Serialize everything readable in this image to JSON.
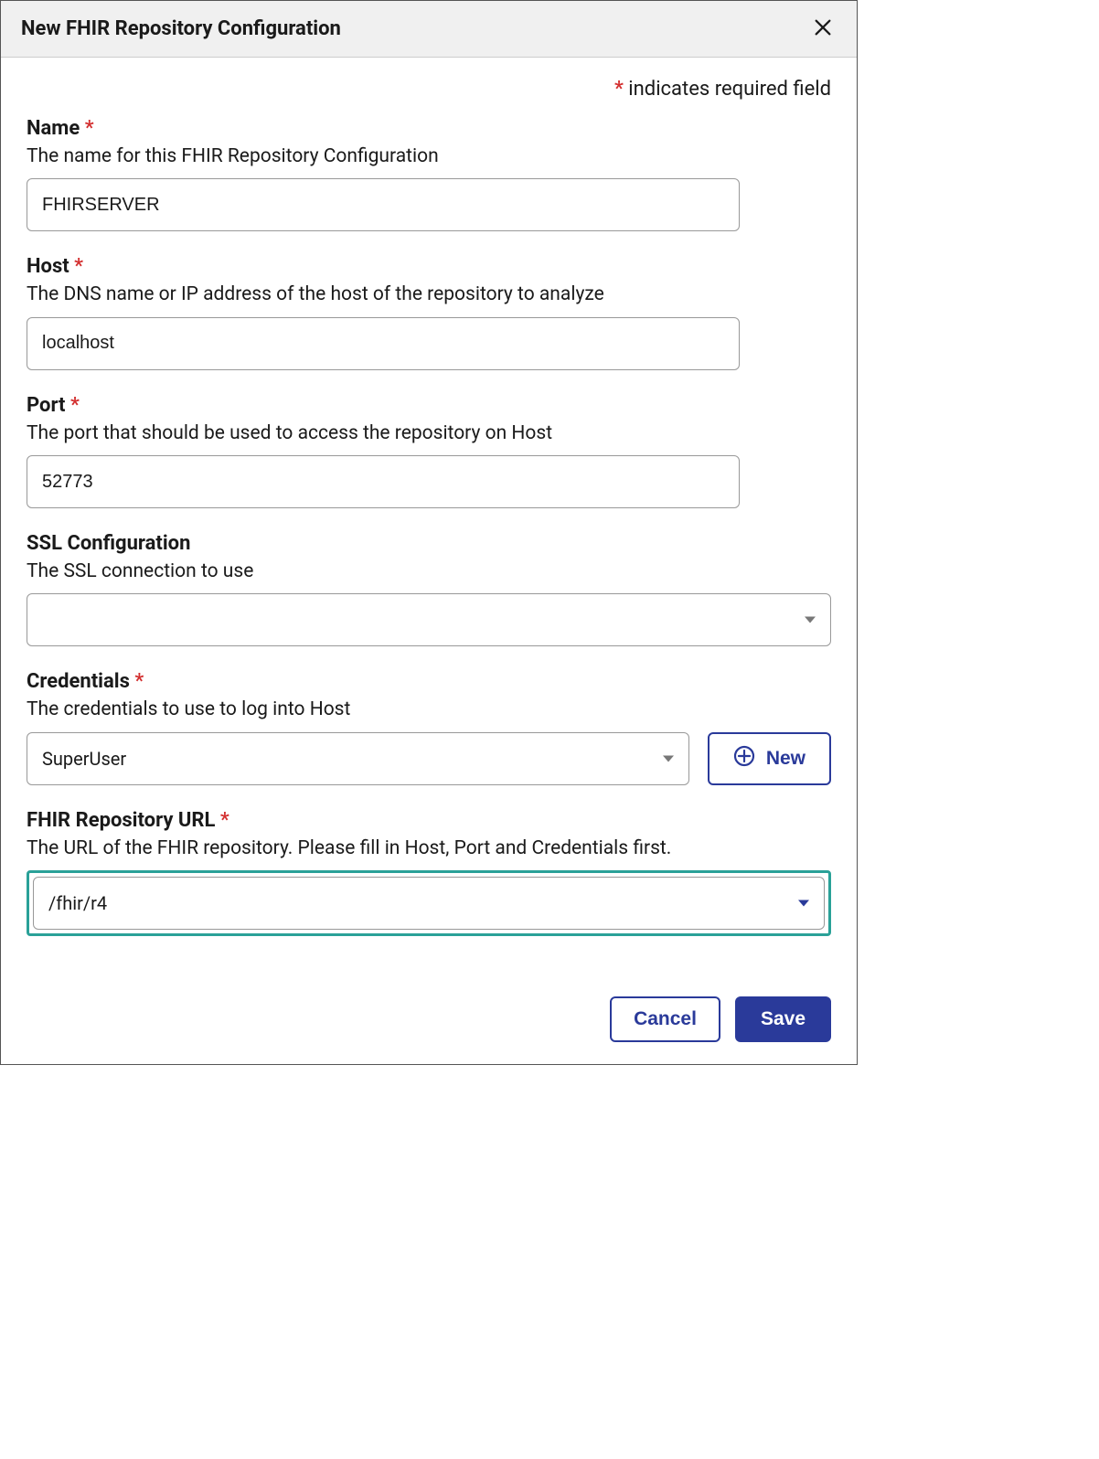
{
  "header": {
    "title": "New FHIR Repository Configuration"
  },
  "required_note": "indicates required field",
  "fields": {
    "name": {
      "label": "Name",
      "required": true,
      "desc": "The name for this FHIR Repository Configuration",
      "value": "FHIRSERVER"
    },
    "host": {
      "label": "Host",
      "required": true,
      "desc": "The DNS name or IP address of the host of the repository to analyze",
      "value": "localhost"
    },
    "port": {
      "label": "Port",
      "required": true,
      "desc": "The port that should be used to access the repository on Host",
      "value": "52773"
    },
    "ssl": {
      "label": "SSL Configuration",
      "required": false,
      "desc": "The SSL connection to use",
      "value": ""
    },
    "credentials": {
      "label": "Credentials",
      "required": true,
      "desc": "The credentials to use to log into Host",
      "value": "SuperUser",
      "new_label": "New"
    },
    "url": {
      "label": "FHIR Repository URL",
      "required": true,
      "desc": "The URL of the FHIR repository. Please fill in Host, Port and Credentials first.",
      "value": "/fhir/r4"
    }
  },
  "footer": {
    "cancel": "Cancel",
    "save": "Save"
  }
}
